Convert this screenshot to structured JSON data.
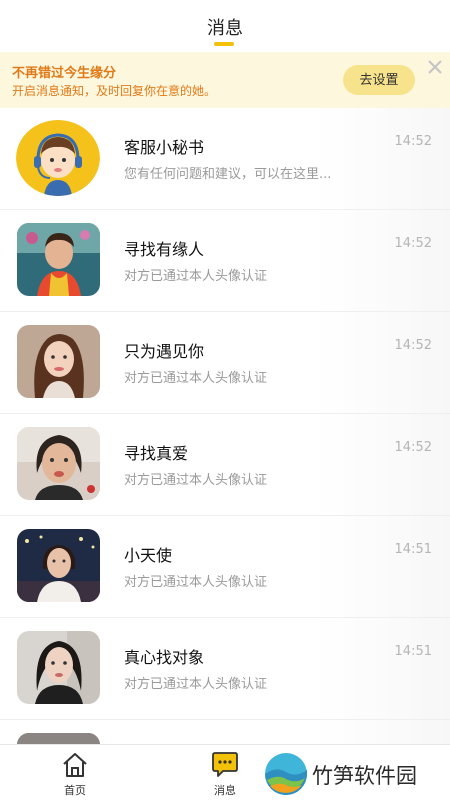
{
  "header": {
    "title": "消息"
  },
  "banner": {
    "title": "不再错过今生缘分",
    "subtitle": "开启消息通知，及时回复你在意的她。",
    "button_label": "去设置"
  },
  "messages": [
    {
      "name": "客服小秘书",
      "preview": "您有任何问题和建议，可以在这里...",
      "time": "14:52",
      "avatar": "service-avatar"
    },
    {
      "name": "寻找有缘人",
      "preview": "对方已通过本人头像认证",
      "time": "14:52",
      "avatar": "user-photo"
    },
    {
      "name": "只为遇见你",
      "preview": "对方已通过本人头像认证",
      "time": "14:52",
      "avatar": "user-photo"
    },
    {
      "name": "寻找真爱",
      "preview": "对方已通过本人头像认证",
      "time": "14:52",
      "avatar": "user-photo"
    },
    {
      "name": "小天使",
      "preview": "对方已通过本人头像认证",
      "time": "14:51",
      "avatar": "user-photo"
    },
    {
      "name": "真心找对象",
      "preview": "对方已通过本人头像认证",
      "time": "14:51",
      "avatar": "user-photo"
    }
  ],
  "tabbar": {
    "home_label": "首页",
    "messages_label": "消息"
  },
  "watermark": {
    "text": "竹笋软件园"
  },
  "colors": {
    "accent": "#f2c10a",
    "banner_bg": "#fdf7de",
    "banner_text": "#e07a18",
    "button_bg": "#f7e38c"
  }
}
